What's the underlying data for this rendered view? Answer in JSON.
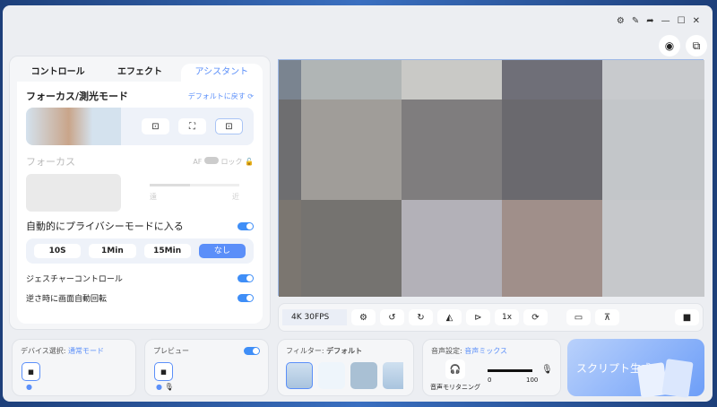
{
  "titlebar": {
    "icons": [
      "gear-icon",
      "pin-icon",
      "share-icon",
      "minimize-icon",
      "maximize-icon",
      "close-icon"
    ]
  },
  "tabs": [
    {
      "label": "コントロール"
    },
    {
      "label": "エフェクト"
    },
    {
      "label": "アシスタント"
    }
  ],
  "focus_mode": {
    "title": "フォーカス/測光モード",
    "reset": "デフォルトに戻す"
  },
  "focus": {
    "title": "フォーカス",
    "af": "AF",
    "lock": "ロック",
    "far": "遠",
    "near": "近",
    "slider_percent": 45
  },
  "privacy": {
    "title": "自動的にプライバシーモードに入る",
    "options": [
      "10S",
      "1Min",
      "15Min",
      "なし"
    ],
    "selected": "なし"
  },
  "gesture": {
    "label": "ジェスチャーコントロール"
  },
  "rotate": {
    "label": "逆さ時に画面自動回転"
  },
  "preview_colors": [
    [
      "#7a8490",
      "#b0b5b5",
      "#c9c9c6",
      "#6f6f78",
      "#c8cacd"
    ],
    [
      "#6e6e70",
      "#a09d99",
      "#7f7d7e",
      "#6a696e",
      "#c3c6c9"
    ],
    [
      "#7b7670",
      "#757370",
      "#b3b1b8",
      "#a08f8a",
      "#c6c8cb"
    ]
  ],
  "controls": {
    "resolution": "4K 30FPS",
    "zoom": "1x"
  },
  "device": {
    "label": "デバイス選択:",
    "mode": "通常モード"
  },
  "preview": {
    "label": "プレビュー"
  },
  "filter": {
    "label": "フィルター:",
    "value": "デフォルト"
  },
  "audio": {
    "label": "音声設定:",
    "value": "音声ミックス",
    "monitor": "音声モリタニング",
    "min": "0",
    "max": "100",
    "volume": 100
  },
  "script": {
    "label": "スクリプト生成"
  }
}
